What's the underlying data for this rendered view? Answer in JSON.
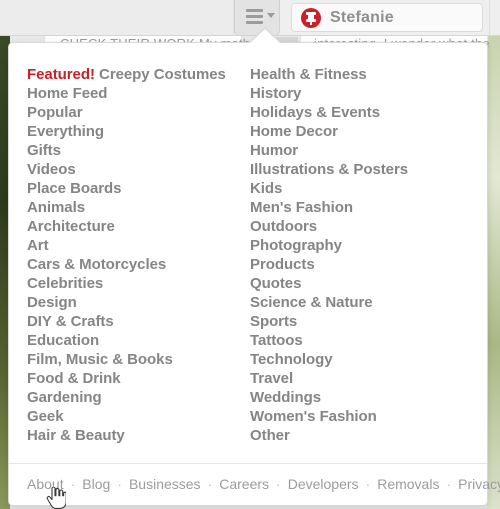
{
  "background": {
    "card_left_text": "CHECK THEIR WORK My math",
    "card_right_text": "interesting. I wonder what the"
  },
  "chrome": {
    "menu_button_name": "category-menu",
    "menu_icon": "hamburger-icon",
    "caret_icon": "chevron-down-icon",
    "account": {
      "name": "Stefanie",
      "icon": "pinterest-pin-icon",
      "brand_color": "#cb2027"
    }
  },
  "panel": {
    "featured": {
      "flag": "Featured!",
      "label": "Creepy Costumes",
      "flag_color": "#cb2027"
    },
    "columns": [
      {
        "name": "left",
        "items": [
          "Home Feed",
          "Popular",
          "Everything",
          "Gifts",
          "Videos",
          "Place Boards",
          "Animals",
          "Architecture",
          "Art",
          "Cars & Motorcycles",
          "Celebrities",
          "Design",
          "DIY & Crafts",
          "Education",
          "Film, Music & Books",
          "Food & Drink",
          "Gardening",
          "Geek",
          "Hair & Beauty"
        ]
      },
      {
        "name": "right",
        "items": [
          "Health & Fitness",
          "History",
          "Holidays & Events",
          "Home Decor",
          "Humor",
          "Illustrations & Posters",
          "Kids",
          "Men's Fashion",
          "Outdoors",
          "Photography",
          "Products",
          "Quotes",
          "Science & Nature",
          "Sports",
          "Tattoos",
          "Technology",
          "Travel",
          "Weddings",
          "Women's Fashion",
          "Other"
        ]
      }
    ],
    "footer": {
      "separator": "·",
      "links": [
        "About",
        "Blog",
        "Businesses",
        "Careers",
        "Developers",
        "Removals",
        "Privacy & Terms"
      ]
    }
  },
  "cursor": {
    "type": "pointer-hand-cursor"
  }
}
